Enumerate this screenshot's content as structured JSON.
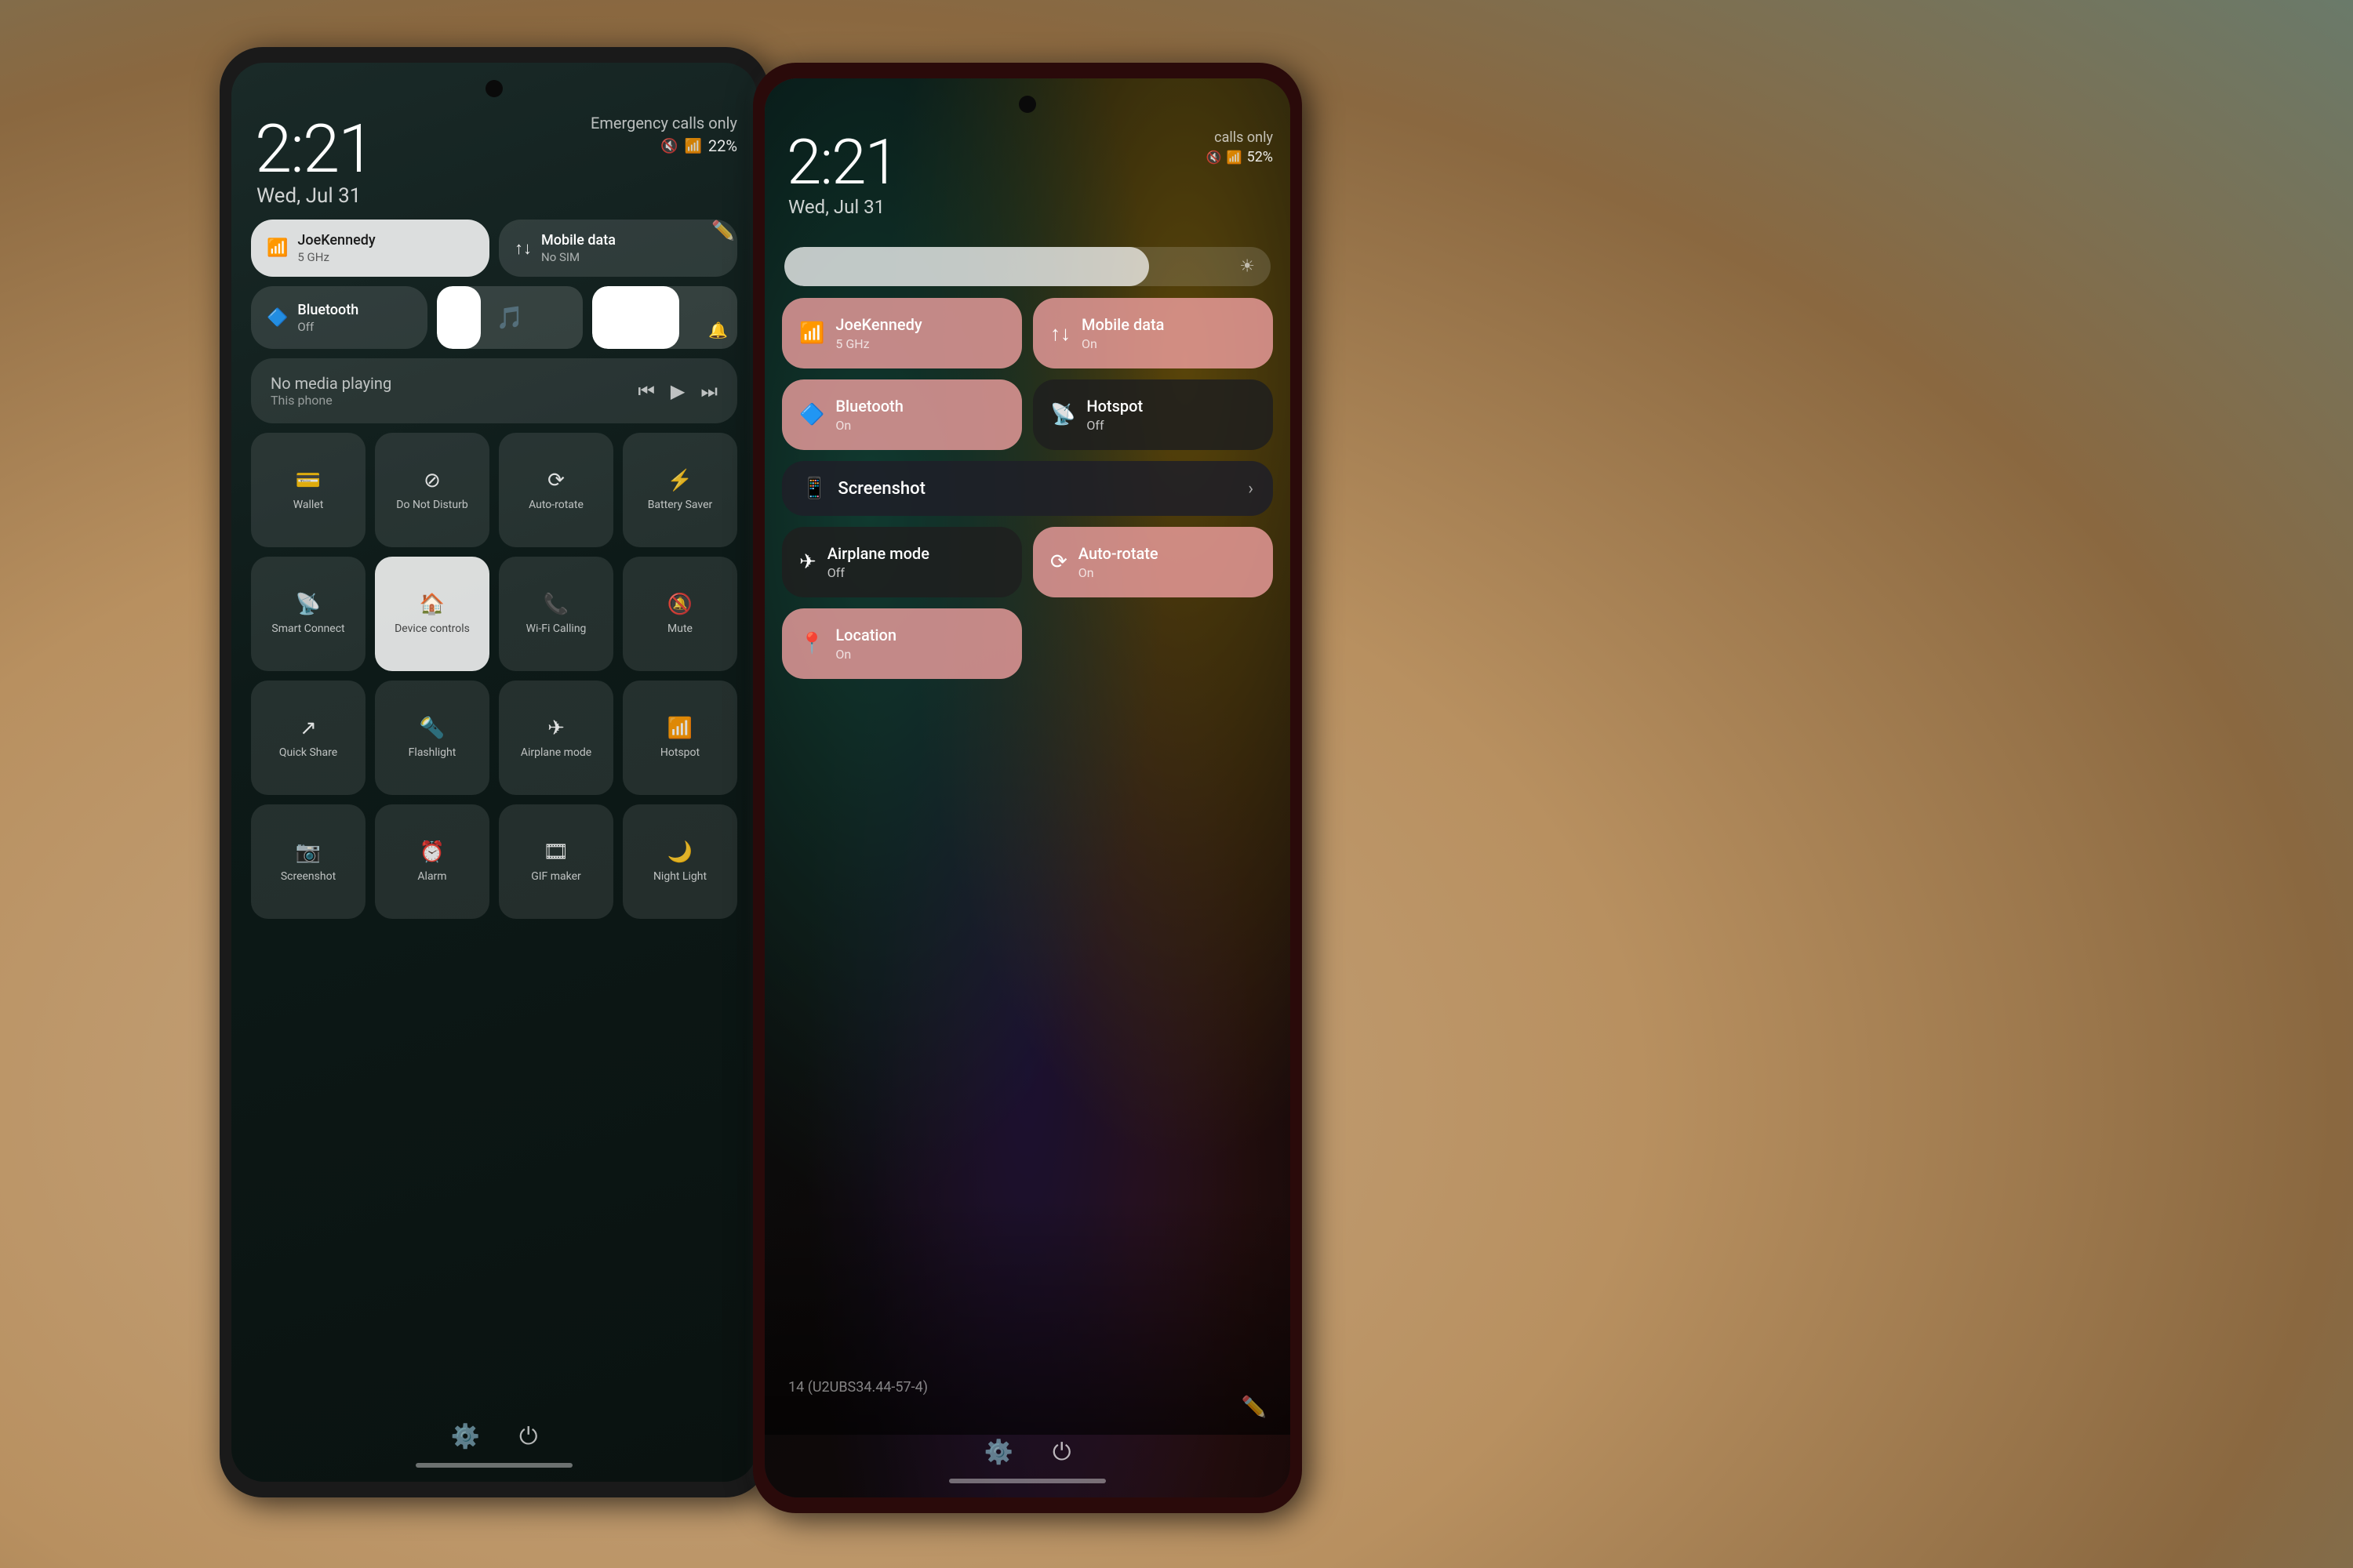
{
  "scene": {
    "background_color": "#7a8a7a"
  },
  "left_phone": {
    "time": "2:21",
    "date": "Wed, Jul 31",
    "emergency_text": "Emergency calls only",
    "battery_percent": "22%",
    "wifi_tile": {
      "title": "JoeKennedy",
      "subtitle": "5 GHz",
      "active": true
    },
    "mobile_tile": {
      "title": "Mobile data",
      "subtitle": "No SIM",
      "active": false
    },
    "bluetooth_tile": {
      "title": "Bluetooth",
      "subtitle": "Off",
      "active": false
    },
    "media": {
      "text": "No media playing",
      "source": "This phone"
    },
    "grid_tiles": [
      {
        "label": "Wallet",
        "icon": "💳",
        "active": false
      },
      {
        "label": "Do Not Disturb",
        "icon": "🚫",
        "active": false
      },
      {
        "label": "Auto-rotate",
        "icon": "🔄",
        "active": false
      },
      {
        "label": "Battery Saver",
        "icon": "⚡",
        "active": false
      },
      {
        "label": "Smart Connect",
        "icon": "📡",
        "active": false
      },
      {
        "label": "Device controls",
        "icon": "🏠",
        "active": true
      },
      {
        "label": "Wi-Fi Calling",
        "icon": "📞",
        "active": false
      },
      {
        "label": "Mute",
        "icon": "🔔",
        "active": false
      },
      {
        "label": "Quick Share",
        "icon": "↗️",
        "active": false
      },
      {
        "label": "Flashlight",
        "icon": "🔦",
        "active": false
      },
      {
        "label": "Airplane mode",
        "icon": "✈️",
        "active": false
      },
      {
        "label": "Hotspot",
        "icon": "📶",
        "active": false
      },
      {
        "label": "Screenshot",
        "icon": "📱",
        "active": false
      },
      {
        "label": "Alarm",
        "icon": "⏰",
        "active": false
      },
      {
        "label": "GIF maker",
        "icon": "🎞️",
        "active": false
      },
      {
        "label": "Night Light",
        "icon": "🌙",
        "active": false
      }
    ],
    "nav": {
      "settings_label": "⚙️",
      "power_label": "⏻"
    }
  },
  "right_phone": {
    "time": "2:21",
    "date": "Wed, Jul 31",
    "emergency_text": "calls only",
    "battery_percent": "52%",
    "tiles": [
      {
        "title": "JoeKennedy",
        "subtitle": "5 GHz",
        "icon": "📶",
        "type": "pink"
      },
      {
        "title": "Mobile data",
        "subtitle": "On",
        "icon": "↑↓",
        "type": "pink"
      },
      {
        "title": "Bluetooth",
        "subtitle": "On",
        "icon": "🔷",
        "type": "pink"
      },
      {
        "title": "Hotspot",
        "subtitle": "Off",
        "icon": "📡",
        "type": "dark"
      },
      {
        "title": "Screenshot",
        "subtitle": "",
        "icon": "📱",
        "type": "dark"
      },
      {
        "title": "Auto-rotate",
        "subtitle": "On",
        "icon": "🔄",
        "type": "pink"
      },
      {
        "title": "Airplane mode",
        "subtitle": "Off",
        "icon": "✈️",
        "type": "dark"
      },
      {
        "title": "Location",
        "subtitle": "On",
        "icon": "📍",
        "type": "pink"
      }
    ],
    "version": "14 (U2UBS34.44-57-4)",
    "nav": {
      "settings_label": "⚙️",
      "power_label": "⏻"
    }
  }
}
